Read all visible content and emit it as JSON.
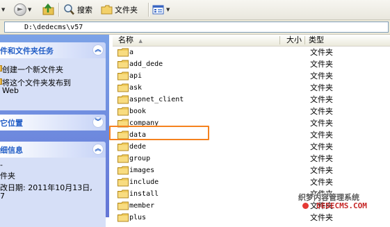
{
  "toolbar": {
    "search_label": "搜索",
    "folders_label": "文件夹"
  },
  "address": {
    "path": "D:\\dedecms\\v57"
  },
  "sidebar": {
    "tasks_panel": {
      "title": "件和文件夹任务",
      "items": [
        {
          "label": "创建一个新文件夹"
        },
        {
          "label_line1": "将这个文件夹发布到",
          "label_line2": "Web"
        }
      ]
    },
    "places_panel": {
      "title": "它位置"
    },
    "details_panel": {
      "title": "细信息",
      "lines": [
        "-",
        "件夹",
        "改日期: 2011年10月13日,",
        "7"
      ]
    },
    "toggle_up": "︽",
    "toggle_down": "︾"
  },
  "file_list": {
    "columns": {
      "name": "名称",
      "size": "大小",
      "type": "类型"
    },
    "sort_arrow": "▲",
    "rows": [
      {
        "name": "a",
        "type": "文件夹"
      },
      {
        "name": "add_dede",
        "type": "文件夹"
      },
      {
        "name": "api",
        "type": "文件夹"
      },
      {
        "name": "ask",
        "type": "文件夹"
      },
      {
        "name": "aspnet_client",
        "type": "文件夹"
      },
      {
        "name": "book",
        "type": "文件夹"
      },
      {
        "name": "company",
        "type": "文件夹"
      },
      {
        "name": "data",
        "type": "文件夹"
      },
      {
        "name": "dede",
        "type": "文件夹"
      },
      {
        "name": "group",
        "type": "文件夹"
      },
      {
        "name": "images",
        "type": "文件夹"
      },
      {
        "name": "include",
        "type": "文件夹"
      },
      {
        "name": "install",
        "type": "文件夹"
      },
      {
        "name": "member",
        "type": "文件夹"
      },
      {
        "name": "plus",
        "type": "文件夹"
      }
    ]
  },
  "highlight": {
    "color": "#f5821f"
  },
  "watermark": {
    "line1": "织梦内容管理系统",
    "line2": "DEDECMS.COM"
  }
}
